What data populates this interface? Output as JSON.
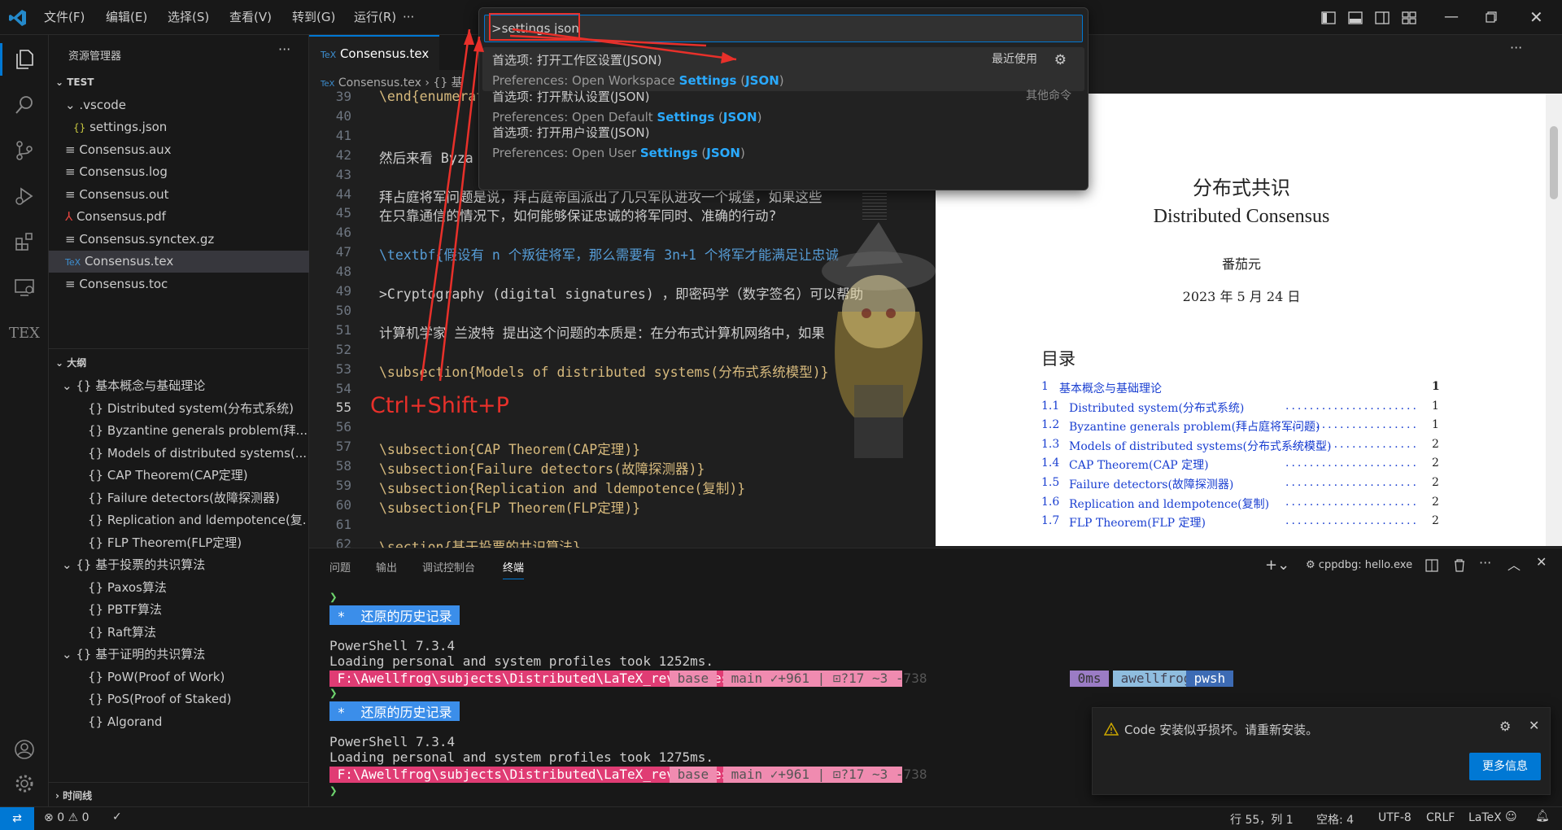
{
  "menu": [
    "文件(F)",
    "编辑(E)",
    "选择(S)",
    "查看(V)",
    "转到(G)",
    "运行(R)",
    "···"
  ],
  "sidebar": {
    "title": "资源管理器",
    "folder": "TEST",
    "files": [
      ".vscode",
      "settings.json",
      "Consensus.aux",
      "Consensus.log",
      "Consensus.out",
      "Consensus.pdf",
      "Consensus.synctex.gz",
      "Consensus.tex",
      "Consensus.toc"
    ],
    "outline_title": "大纲",
    "outline": [
      "基本概念与基础理论",
      "Distributed system(分布式系统)",
      "Byzantine generals problem(拜...",
      "Models of distributed systems(...",
      "CAP Theorem(CAP定理)",
      "Failure detectors(故障探测器)",
      "Replication and ldempotence(复...",
      "FLP Theorem(FLP定理)",
      "基于投票的共识算法",
      "Paxos算法",
      "PBTF算法",
      "Raft算法",
      "基于证明的共识算法",
      "PoW(Proof of Work)",
      "PoS(Proof of Staked)",
      "Algorand"
    ],
    "timeline": "时间线"
  },
  "editor": {
    "tab": "Consensus.tex",
    "breadcrumb": "Consensus.tex",
    "breadcrumb_more": "{} 基",
    "lines": [
      {
        "n": "39",
        "t": "\\end{enumerat"
      },
      {
        "n": "40",
        "t": ""
      },
      {
        "n": "41",
        "t": ""
      },
      {
        "n": "42",
        "t": "然后来看 Byza"
      },
      {
        "n": "43",
        "t": ""
      },
      {
        "n": "44",
        "t": "拜占庭将军问题是说，拜占庭帝国派出了几只军队进攻一个城堡，如果这些"
      },
      {
        "n": "45",
        "t": "在只靠通信的情况下，如何能够保证忠诚的将军同时、准确的行动?"
      },
      {
        "n": "46",
        "t": ""
      },
      {
        "n": "47",
        "t": "\\textbf{假设有 n 个叛徒将军，那么需要有 3n+1 个将军才能满足让忠诚"
      },
      {
        "n": "48",
        "t": ""
      },
      {
        "n": "49",
        "t": ">Cryptography (digital signatures) ，即密码学（数字签名）可以帮助"
      },
      {
        "n": "50",
        "t": ""
      },
      {
        "n": "51",
        "t": "计算机学家 兰波特 提出这个问题的本质是：在分布式计算机网络中，如果"
      },
      {
        "n": "52",
        "t": ""
      },
      {
        "n": "53",
        "t": "\\subsection{Models of distributed systems(分布式系统模型)}"
      },
      {
        "n": "54",
        "t": ""
      },
      {
        "n": "55",
        "t": ""
      },
      {
        "n": "56",
        "t": ""
      },
      {
        "n": "57",
        "t": "\\subsection{CAP Theorem(CAP定理)}"
      },
      {
        "n": "58",
        "t": "\\subsection{Failure detectors(故障探测器)}"
      },
      {
        "n": "59",
        "t": "\\subsection{Replication and ldempotence(复制)}"
      },
      {
        "n": "60",
        "t": "\\subsection{FLP Theorem(FLP定理)}"
      },
      {
        "n": "61",
        "t": ""
      },
      {
        "n": "62",
        "t": "\\section{基于投票的共识算法}"
      }
    ],
    "annotation": "Ctrl+Shift+P"
  },
  "palette": {
    "input": ">settings json",
    "items": [
      {
        "title": "首选项: 打开工作区设置(JSON)",
        "pre": "Preferences: Open Workspace ",
        "kw": "Settings",
        "mid": " (",
        "kw2": "JSON",
        "post": ")",
        "tag": "最近使用"
      },
      {
        "title": "首选项: 打开默认设置(JSON)",
        "pre": "Preferences: Open Default ",
        "kw": "Settings",
        "mid": " (",
        "kw2": "JSON",
        "post": ")",
        "tag": "其他命令"
      },
      {
        "title": "首选项: 打开用户设置(JSON)",
        "pre": "Preferences: Open User ",
        "kw": "Settings",
        "mid": " (",
        "kw2": "JSON",
        "post": ")",
        "tag": ""
      }
    ]
  },
  "preview": {
    "title_cn": "分布式共识",
    "title_en": "Distributed Consensus",
    "author": "番茄元",
    "date": "2023 年 5 月 24 日",
    "toc_title": "目录",
    "toc": [
      {
        "num": "1",
        "text": "基本概念与基础理论",
        "page": "1"
      },
      {
        "num": "1.1",
        "text": "Distributed system(分布式系统)",
        "page": "1"
      },
      {
        "num": "1.2",
        "text": "Byzantine generals problem(拜占庭将军问题)",
        "page": "1"
      },
      {
        "num": "1.3",
        "text": "Models of distributed systems(分布式系统模型)",
        "page": "2"
      },
      {
        "num": "1.4",
        "text": "CAP Theorem(CAP 定理)",
        "page": "2"
      },
      {
        "num": "1.5",
        "text": "Failure detectors(故障探测器)",
        "page": "2"
      },
      {
        "num": "1.6",
        "text": "Replication and ldempotence(复制)",
        "page": "2"
      },
      {
        "num": "1.7",
        "text": "FLP Theorem(FLP 定理)",
        "page": "2"
      }
    ]
  },
  "panel": {
    "tabs": [
      "问题",
      "输出",
      "调试控制台",
      "终端"
    ],
    "active_tab": "终端",
    "terminal_name": "cppdbg: hello.exe",
    "prompt": "❯",
    "restore": " *  还原的历史记录 ",
    "ps_version": "PowerShell 7.3.4",
    "load1": "Loading personal and system profiles took 1252ms.",
    "load2": "Loading personal and system profiles took 1275ms.",
    "path": " F:\\Awellfrog\\subjects\\Distributed\\LaTeX_review\\test ",
    "env": " base ",
    "git": " main ✓+961 | ⊡?17 ~3 -738 ",
    "right_ms": " 0ms ",
    "right_user": " awellfrog ",
    "right_shell": " pwsh "
  },
  "notification": {
    "message": "Code 安装似乎损坏。请重新安装。",
    "button": "更多信息"
  },
  "status": {
    "errors": "0",
    "warnings": "0",
    "position": "行 55，列 1",
    "spaces": "空格: 4",
    "encoding": "UTF-8",
    "eol": "CRLF",
    "lang": "LaTeX"
  }
}
